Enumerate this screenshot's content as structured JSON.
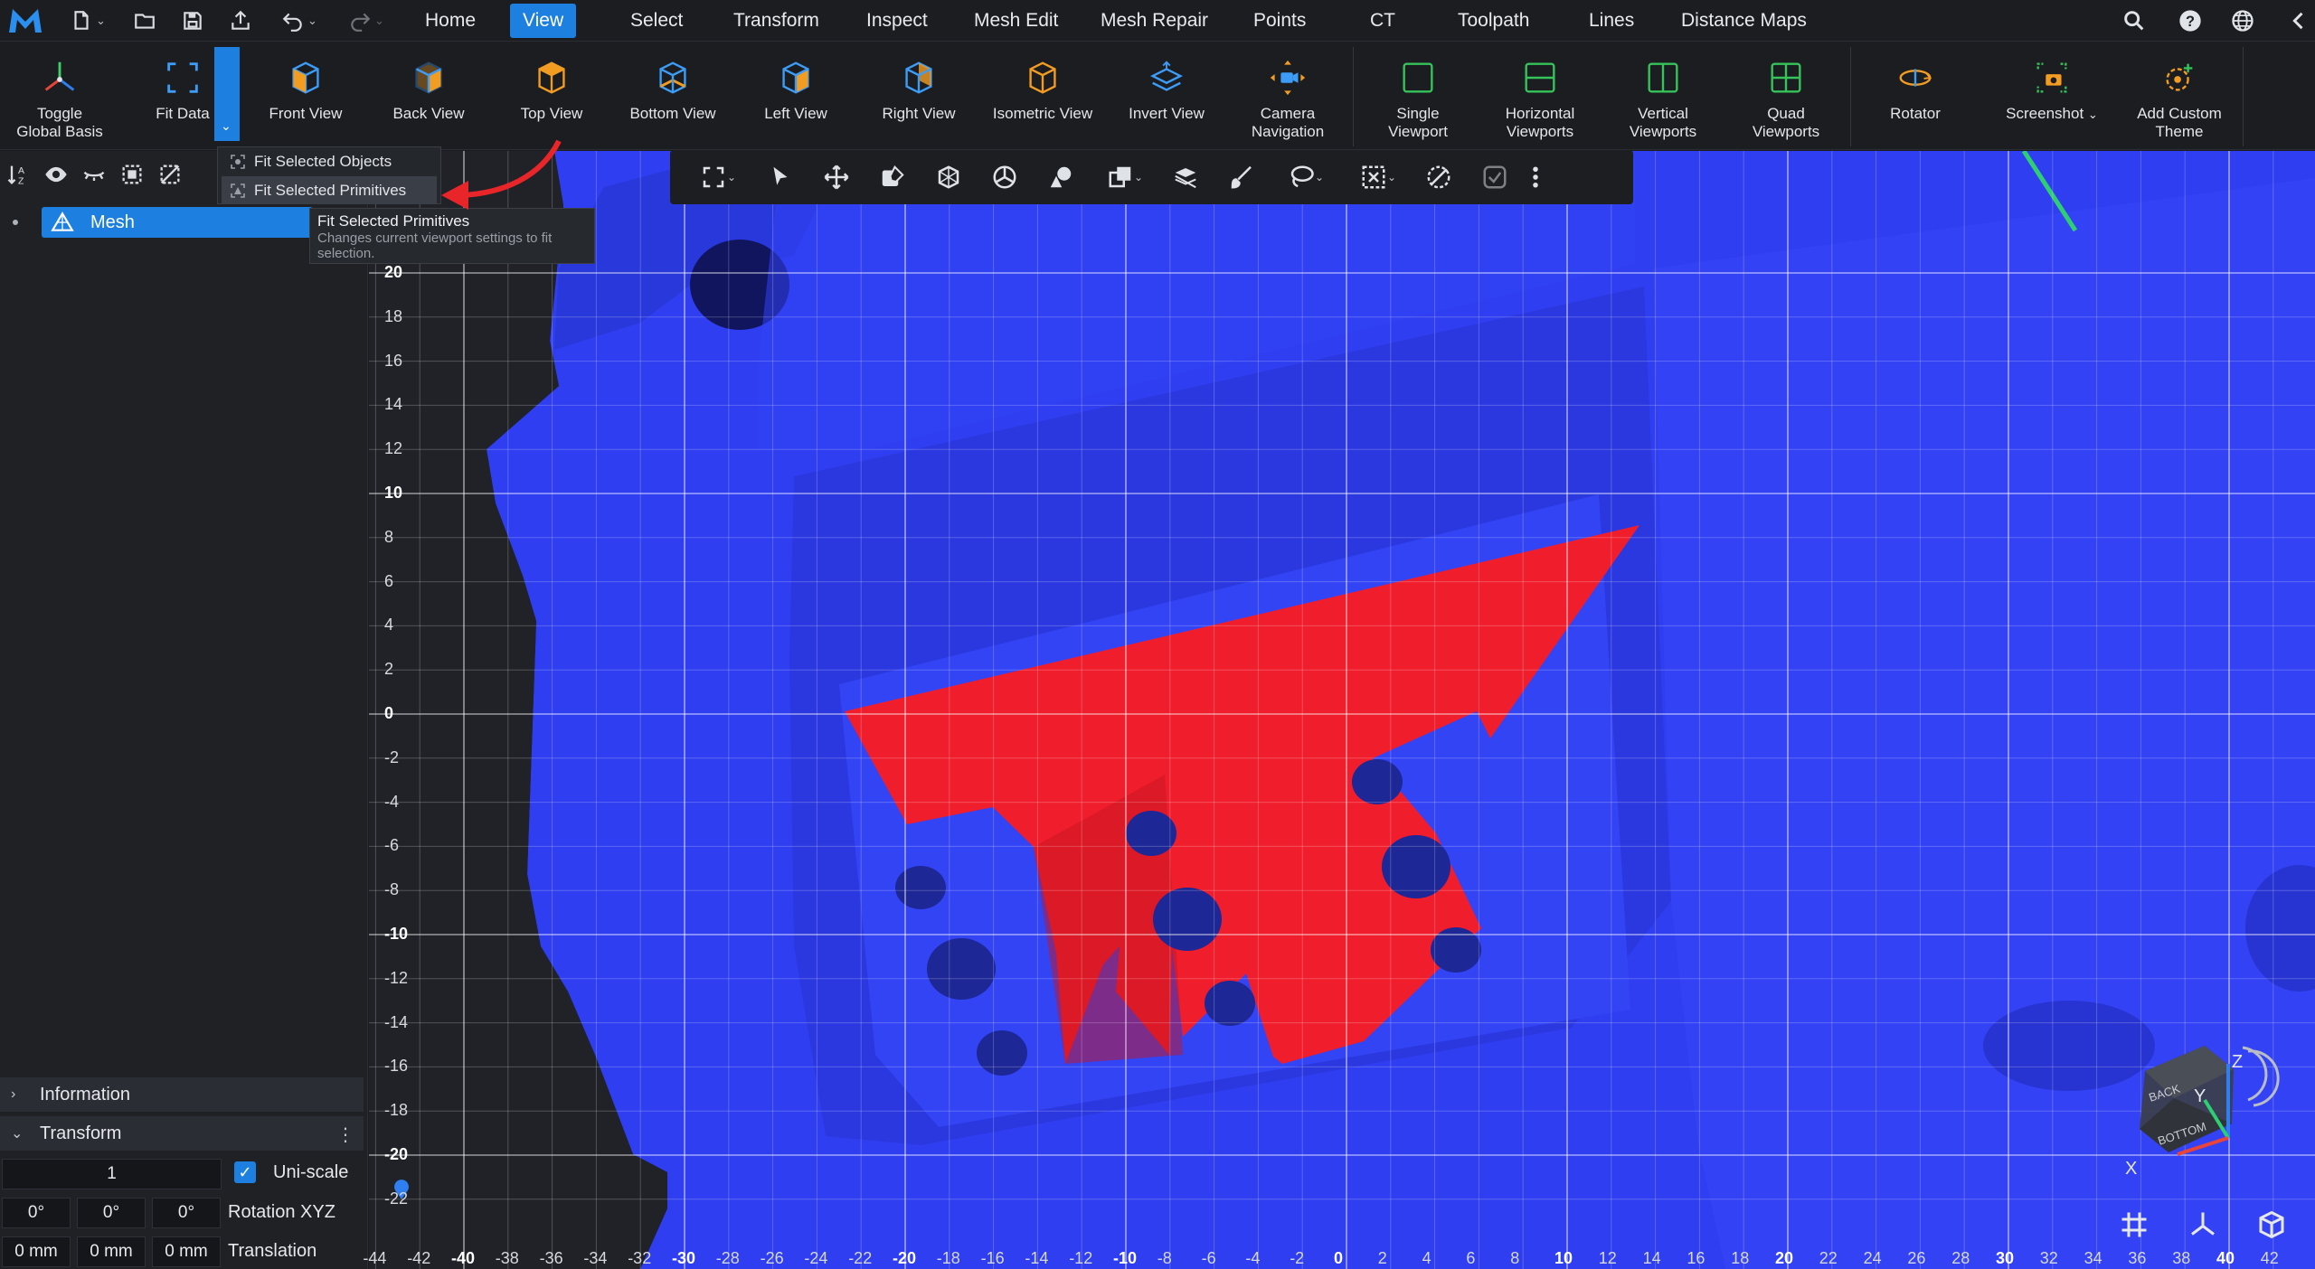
{
  "menubar": {
    "tabs": [
      "Home",
      "View",
      "Select",
      "Transform",
      "Inspect",
      "Mesh Edit",
      "Mesh Repair",
      "Points",
      "CT",
      "Toolpath",
      "Lines",
      "Distance Maps"
    ],
    "active_tab": "View"
  },
  "ribbon": {
    "buttons": [
      {
        "label": "Toggle\nGlobal Basis",
        "icon": "global-basis-icon"
      },
      {
        "label": "Fit Data",
        "icon": "fit-data-icon"
      },
      {
        "label": "Front View",
        "icon": "front-view-icon"
      },
      {
        "label": "Back View",
        "icon": "back-view-icon"
      },
      {
        "label": "Top View",
        "icon": "top-view-icon"
      },
      {
        "label": "Bottom View",
        "icon": "bottom-view-icon"
      },
      {
        "label": "Left View",
        "icon": "left-view-icon"
      },
      {
        "label": "Right View",
        "icon": "right-view-icon"
      },
      {
        "label": "Isometric View",
        "icon": "isometric-view-icon"
      },
      {
        "label": "Invert View",
        "icon": "invert-view-icon"
      },
      {
        "label": "Camera\nNavigation",
        "icon": "camera-navigation-icon"
      },
      {
        "label": "Single\nViewport",
        "icon": "single-viewport-icon"
      },
      {
        "label": "Horizontal\nViewports",
        "icon": "horizontal-viewports-icon"
      },
      {
        "label": "Vertical\nViewports",
        "icon": "vertical-viewports-icon"
      },
      {
        "label": "Quad\nViewports",
        "icon": "quad-viewports-icon"
      },
      {
        "label": "Rotator",
        "icon": "rotator-icon"
      },
      {
        "label": "Screenshot",
        "icon": "screenshot-icon"
      },
      {
        "label": "Add Custom\nTheme",
        "icon": "add-custom-theme-icon"
      }
    ]
  },
  "dropdown": {
    "items": [
      "Fit Selected Objects",
      "Fit Selected Primitives"
    ],
    "highlighted": "Fit Selected Primitives",
    "tooltip_title": "Fit Selected Primitives",
    "tooltip_desc": "Changes current viewport settings to fit selection."
  },
  "scene_tree": {
    "items": [
      {
        "label": "Mesh",
        "selected": true
      }
    ]
  },
  "panels": {
    "information": "Information",
    "transform": "Transform",
    "scale_value": "1",
    "uniscale_label": "Uni-scale",
    "uniscale_checked": true,
    "rotation": [
      "0°",
      "0°",
      "0°"
    ],
    "rotation_label": "Rotation XYZ",
    "translation": [
      "0 mm",
      "0 mm",
      "0 mm"
    ],
    "translation_label": "Translation"
  },
  "viewport": {
    "x_ticks": [
      "-44",
      "-42",
      "-40",
      "-38",
      "-36",
      "-34",
      "-32",
      "-30",
      "-28",
      "-26",
      "-24",
      "-22",
      "-20",
      "-18",
      "-16",
      "-14",
      "-12",
      "-10",
      "-8",
      "-6",
      "-4",
      "-2",
      "0",
      "2",
      "4",
      "6",
      "8",
      "10",
      "12",
      "14",
      "16",
      "18",
      "20",
      "22",
      "24",
      "26",
      "28",
      "30",
      "32",
      "34",
      "36",
      "38",
      "40",
      "42"
    ],
    "y_ticks": [
      "20",
      "18",
      "16",
      "14",
      "12",
      "10",
      "8",
      "6",
      "4",
      "2",
      "0",
      "-2",
      "-4",
      "-6",
      "-8",
      "-10",
      "-12",
      "-14",
      "-16",
      "-18",
      "-20",
      "-22"
    ],
    "cube_labels": {
      "back": "BACK",
      "bottom": "BOTTOM"
    },
    "axis_labels": {
      "x": "X",
      "y": "Y",
      "z": "Z"
    },
    "colors": {
      "mesh": "#2f3ef0",
      "selection": "#f01e2c",
      "accent": "#1d7fe0",
      "background": "#202227"
    }
  }
}
